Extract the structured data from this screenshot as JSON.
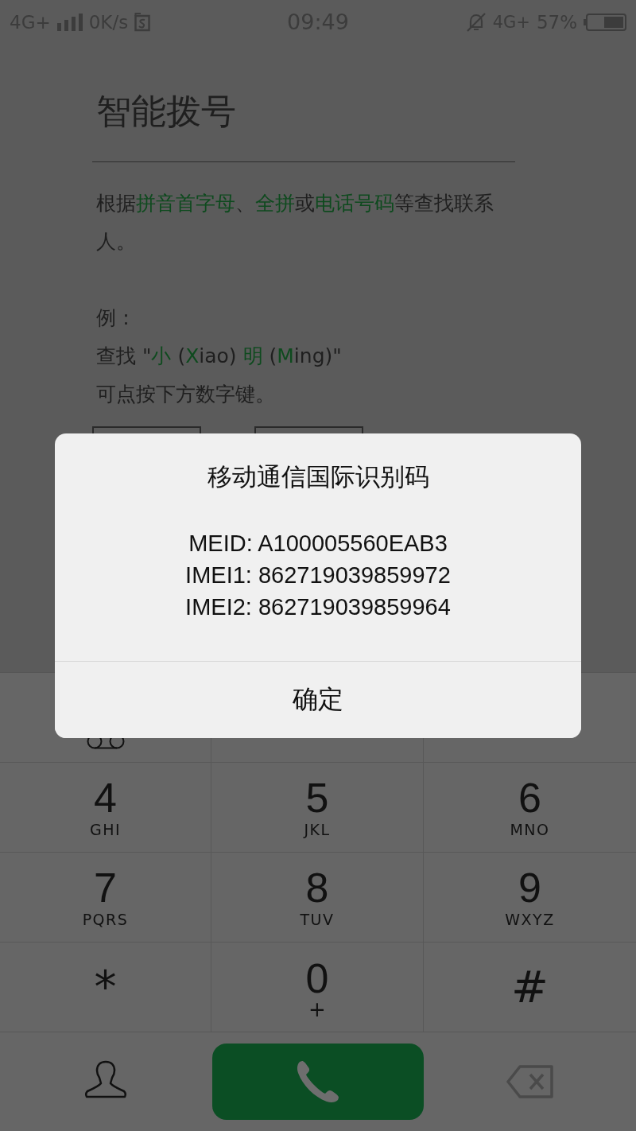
{
  "status_bar": {
    "network_left": "4G+",
    "speed": "0K/s",
    "time": "09:49",
    "network_right": "4G+",
    "battery": "57%"
  },
  "heading": "智能拨号",
  "intro": [
    {
      "text": "根据",
      "highlight": false
    },
    {
      "text": "拼音首字母",
      "highlight": true
    },
    {
      "text": "、",
      "highlight": false
    },
    {
      "text": "全拼",
      "highlight": true
    },
    {
      "text": "或",
      "highlight": false
    },
    {
      "text": "电话号码",
      "highlight": true
    },
    {
      "text": "等查找联系人。",
      "highlight": false
    }
  ],
  "example_label": "例：",
  "example": [
    {
      "text": "查找 \"",
      "highlight": false
    },
    {
      "text": "小",
      "highlight": true
    },
    {
      "text": " (",
      "highlight": false
    },
    {
      "text": "X",
      "highlight": true
    },
    {
      "text": "iao) ",
      "highlight": false
    },
    {
      "text": "明",
      "highlight": true
    },
    {
      "text": " (",
      "highlight": false
    },
    {
      "text": "M",
      "highlight": true
    },
    {
      "text": "ing)\"",
      "highlight": false
    }
  ],
  "hint": "可点按下方数字键。",
  "keypad": [
    {
      "kind": "voicemail"
    },
    {
      "kind": "covered"
    },
    {
      "kind": "covered"
    },
    {
      "kind": "digit",
      "digit": "4",
      "letters": "GHI"
    },
    {
      "kind": "digit",
      "digit": "5",
      "letters": "JKL"
    },
    {
      "kind": "digit",
      "digit": "6",
      "letters": "MNO"
    },
    {
      "kind": "digit",
      "digit": "7",
      "letters": "PQRS"
    },
    {
      "kind": "digit",
      "digit": "8",
      "letters": "TUV"
    },
    {
      "kind": "digit",
      "digit": "9",
      "letters": "WXYZ"
    },
    {
      "kind": "symbol",
      "digit": "*"
    },
    {
      "kind": "digit",
      "digit": "0",
      "letters": "+"
    },
    {
      "kind": "symbol",
      "digit": "#"
    }
  ],
  "dialog": {
    "title": "移动通信国际识别码",
    "lines": [
      "MEID: A100005560EAB3",
      "IMEI1: 862719039859972",
      "IMEI2: 862719039859964"
    ],
    "button": "确定"
  }
}
